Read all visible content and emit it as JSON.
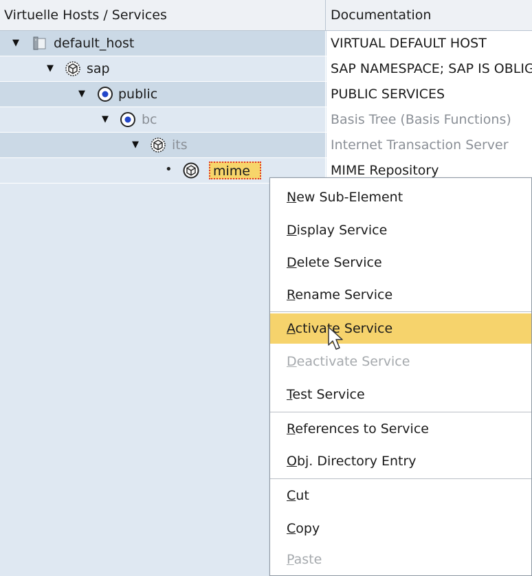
{
  "tree": {
    "columns": {
      "services": "Virtuelle Hosts / Services",
      "documentation": "Documentation"
    },
    "rows": [
      {
        "label": "default_host",
        "doc": "VIRTUAL DEFAULT HOST",
        "expander": "▼",
        "icon": "host-icon"
      },
      {
        "label": "sap",
        "doc": "SAP NAMESPACE; SAP IS OBLIGED NOT TO DELIVER ANY OBJECTS IN THIS NAMESPACE",
        "expander": "▼",
        "icon": "service-cube-icon"
      },
      {
        "label": "public",
        "doc": "PUBLIC SERVICES",
        "expander": "▼",
        "icon": "active-service-icon"
      },
      {
        "label": "bc",
        "doc": "Basis Tree (Basis Functions)",
        "expander": "▼",
        "icon": "active-service-icon"
      },
      {
        "label": "its",
        "doc": "Internet Transaction Server",
        "expander": "▼",
        "icon": "service-cube-icon"
      },
      {
        "label": "mime",
        "doc": "MIME Repository",
        "expander": "•",
        "icon": "service-cube-icon"
      }
    ]
  },
  "context_menu": {
    "items": [
      {
        "label": "New Sub-Element",
        "key": "N",
        "rest": "ew Sub-Element"
      },
      {
        "label": "Display Service",
        "key": "D",
        "rest": "isplay Service"
      },
      {
        "label": "Delete Service",
        "key": "D",
        "rest": "elete Service"
      },
      {
        "label": "Rename Service",
        "key": "R",
        "rest": "ename Service"
      },
      {
        "label": "Activate Service",
        "key": "A",
        "rest": "ctivate Service"
      },
      {
        "label": "Deactivate Service",
        "key": "D",
        "rest": "eactivate Service"
      },
      {
        "label": "Test Service",
        "key": "T",
        "rest": "est Service"
      },
      {
        "label": "References to Service",
        "key": "R",
        "rest": "eferences to Service"
      },
      {
        "label": "Obj. Directory Entry",
        "key": "O",
        "rest": "bj. Directory Entry"
      },
      {
        "label": "Cut",
        "key": "C",
        "rest": "ut"
      },
      {
        "label": "Copy",
        "key": "C",
        "rest": "opy"
      },
      {
        "label": "Paste",
        "key": "P",
        "rest": "aste"
      }
    ]
  },
  "colors": {
    "highlight": "#f6d36c",
    "tree_background": "#dfe8f2",
    "selection_border": "#e0322b"
  }
}
